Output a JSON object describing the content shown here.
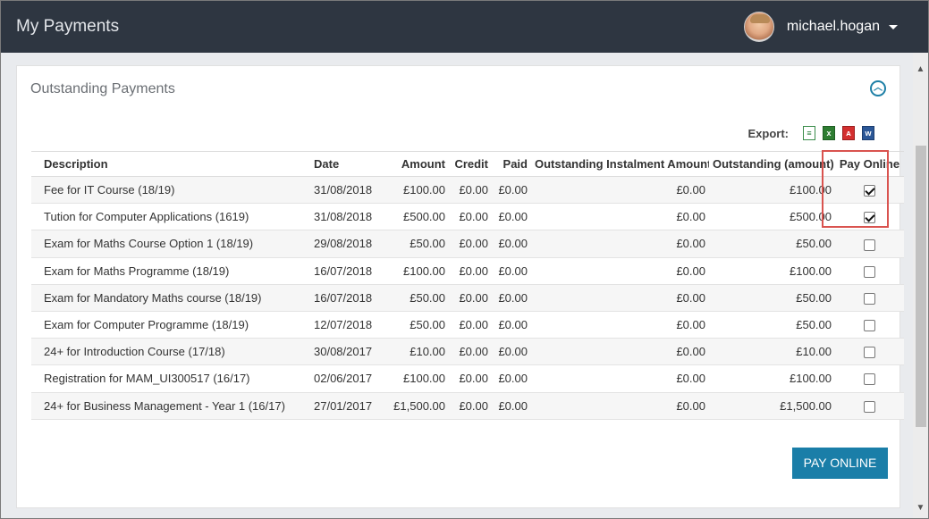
{
  "header": {
    "app_title": "My Payments",
    "username": "michael.hogan",
    "avatar_icon": "user-avatar",
    "background_color": "#2e3641"
  },
  "panel": {
    "title": "Outstanding Payments",
    "collapse_icon": "chevron-up-circle-icon"
  },
  "export": {
    "label": "Export:",
    "formats": [
      "csv",
      "xls",
      "pdf",
      "doc"
    ]
  },
  "table": {
    "columns": [
      "Description",
      "Date",
      "Amount",
      "Credit",
      "Paid",
      "Outstanding Instalment Amount",
      "Outstanding (amount)",
      "Pay Online"
    ],
    "rows": [
      {
        "description": "Fee for IT Course (18/19)",
        "date": "31/08/2018",
        "amount": "£100.00",
        "credit": "£0.00",
        "paid": "£0.00",
        "instalment": "£0.00",
        "outstanding": "£100.00",
        "pay_online": true
      },
      {
        "description": "Tution for Computer Applications (1619)",
        "date": "31/08/2018",
        "amount": "£500.00",
        "credit": "£0.00",
        "paid": "£0.00",
        "instalment": "£0.00",
        "outstanding": "£500.00",
        "pay_online": true
      },
      {
        "description": "Exam for Maths Course Option 1 (18/19)",
        "date": "29/08/2018",
        "amount": "£50.00",
        "credit": "£0.00",
        "paid": "£0.00",
        "instalment": "£0.00",
        "outstanding": "£50.00",
        "pay_online": false
      },
      {
        "description": "Exam for Maths Programme (18/19)",
        "date": "16/07/2018",
        "amount": "£100.00",
        "credit": "£0.00",
        "paid": "£0.00",
        "instalment": "£0.00",
        "outstanding": "£100.00",
        "pay_online": false
      },
      {
        "description": "Exam for Mandatory Maths course (18/19)",
        "date": "16/07/2018",
        "amount": "£50.00",
        "credit": "£0.00",
        "paid": "£0.00",
        "instalment": "£0.00",
        "outstanding": "£50.00",
        "pay_online": false
      },
      {
        "description": "Exam for Computer Programme (18/19)",
        "date": "12/07/2018",
        "amount": "£50.00",
        "credit": "£0.00",
        "paid": "£0.00",
        "instalment": "£0.00",
        "outstanding": "£50.00",
        "pay_online": false
      },
      {
        "description": "24+  for Introduction Course (17/18)",
        "date": "30/08/2017",
        "amount": "£10.00",
        "credit": "£0.00",
        "paid": "£0.00",
        "instalment": "£0.00",
        "outstanding": "£10.00",
        "pay_online": false
      },
      {
        "description": "Registration for MAM_UI300517 (16/17)",
        "date": "02/06/2017",
        "amount": "£100.00",
        "credit": "£0.00",
        "paid": "£0.00",
        "instalment": "£0.00",
        "outstanding": "£100.00",
        "pay_online": false
      },
      {
        "description": "24+ for Business Management - Year 1 (16/17)",
        "date": "27/01/2017",
        "amount": "£1,500.00",
        "credit": "£0.00",
        "paid": "£0.00",
        "instalment": "£0.00",
        "outstanding": "£1,500.00",
        "pay_online": false
      }
    ]
  },
  "actions": {
    "pay_online_label": "PAY ONLINE",
    "button_color": "#1a7ea8",
    "highlight_color": "#d9534f"
  }
}
